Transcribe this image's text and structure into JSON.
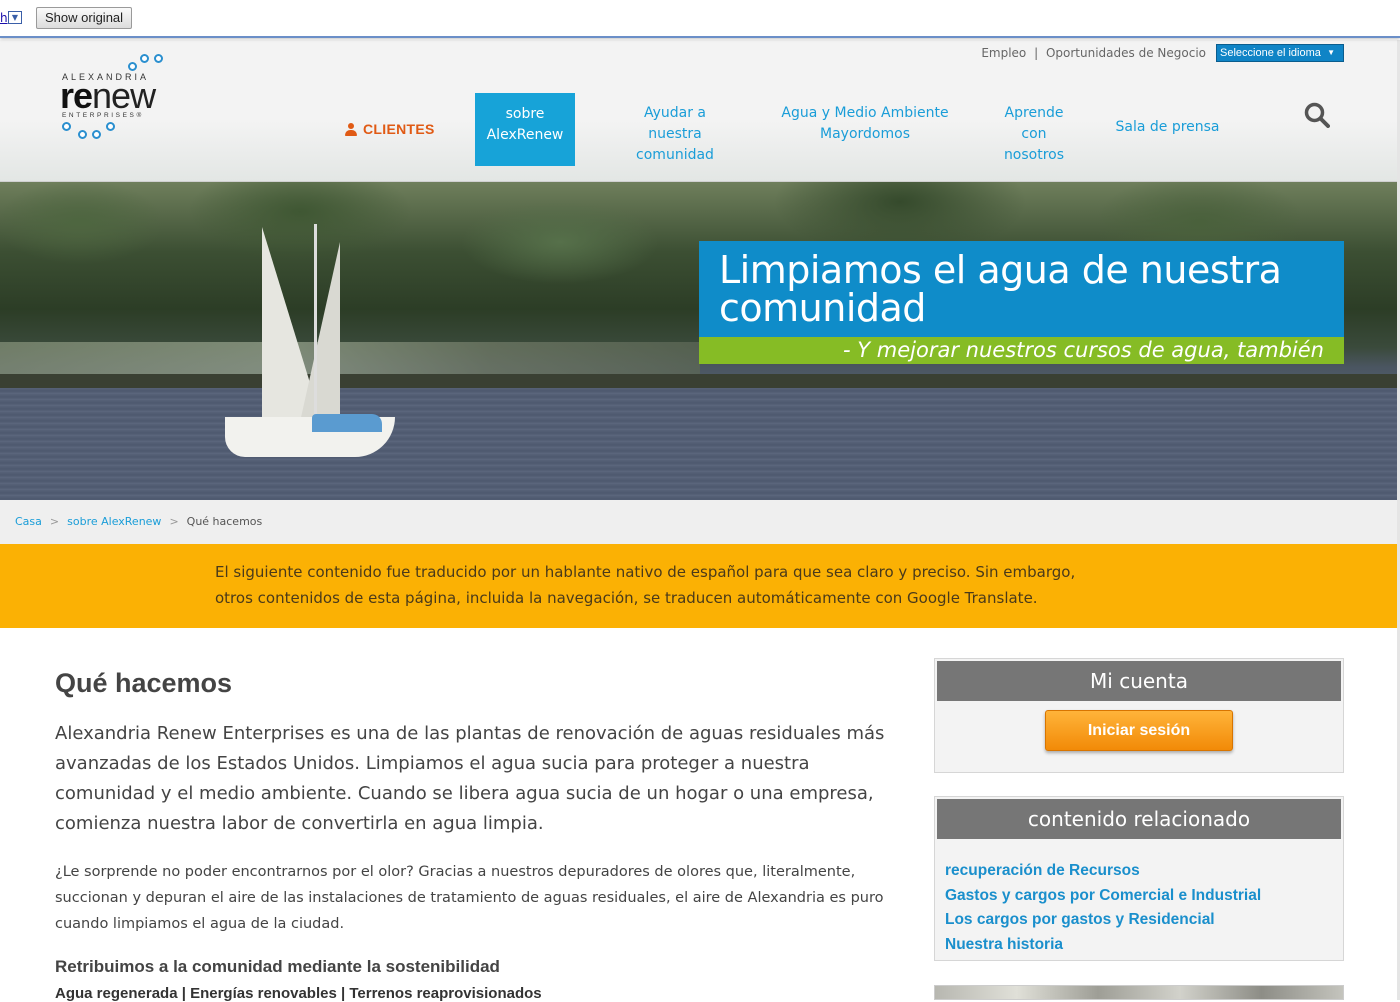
{
  "translate_bar": {
    "link_text": "h",
    "dropdown_glyph": "▼",
    "show_original": "Show original"
  },
  "header": {
    "logo": {
      "top": "ALEXANDRIA",
      "wordmark_re": "re",
      "wordmark_new": "new",
      "bottom": "ENTERPRISES®"
    },
    "utility_links": [
      "Empleo",
      "Oportunidades de Negocio"
    ],
    "utility_separator": "|",
    "language_select": "Seleccione el idioma",
    "nav": {
      "clientes": "CLIENTES",
      "sobre": "sobre AlexRenew",
      "ayudar": "Ayudar a nuestra comunidad",
      "agua": "Agua y Medio Ambiente Mayordomos",
      "aprende": "Aprende con nosotros",
      "sala": "Sala de prensa"
    }
  },
  "hero": {
    "headline": "Limpiamos el agua de nuestra comunidad",
    "subline": "- Y mejorar nuestros cursos de agua, también"
  },
  "breadcrumb": {
    "items": [
      "Casa",
      "sobre AlexRenew"
    ],
    "separator": ">",
    "current": "Qué hacemos"
  },
  "notice": {
    "text": "El siguiente contenido fue traducido por un hablante nativo de español para que sea claro y preciso. Sin embargo, otros contenidos de esta página, incluida la navegación, se traducen automáticamente con Google Translate."
  },
  "main": {
    "title": "Qué hacemos",
    "lead": "Alexandria Renew Enterprises es una de las plantas de renovación de aguas residuales más avanzadas de los Estados Unidos. Limpiamos el agua sucia para proteger a nuestra comunidad y el medio ambiente. Cuando se libera agua sucia de un hogar o una empresa, comienza nuestra labor de convertirla en agua limpia.",
    "paragraph": "¿Le sorprende no poder encontrarnos por el olor? Gracias a nuestros depuradores de olores que, literalmente, succionan y depuran el aire de las instalaciones de tratamiento de aguas residuales, el aire de Alexandria es puro cuando limpiamos el agua de la ciudad.",
    "subheading": "Retribuimos a la comunidad mediante la sostenibilidad",
    "tags": "Agua regenerada | Energías renovables | Terrenos reaprovisionados"
  },
  "sidebar": {
    "account": {
      "title": "Mi cuenta",
      "login": "Iniciar sesión"
    },
    "related": {
      "title": "contenido relacionado",
      "links": [
        "recuperación de Recursos",
        "Gastos y cargos por Comercial e Industrial",
        "Los cargos por gastos y Residencial",
        "Nuestra historia"
      ]
    }
  },
  "colors": {
    "brand_blue": "#0f8cc9",
    "nav_blue": "#1a9dd8",
    "green": "#86bc25",
    "orange": "#e05a14",
    "notice_yellow": "#fbb104"
  }
}
